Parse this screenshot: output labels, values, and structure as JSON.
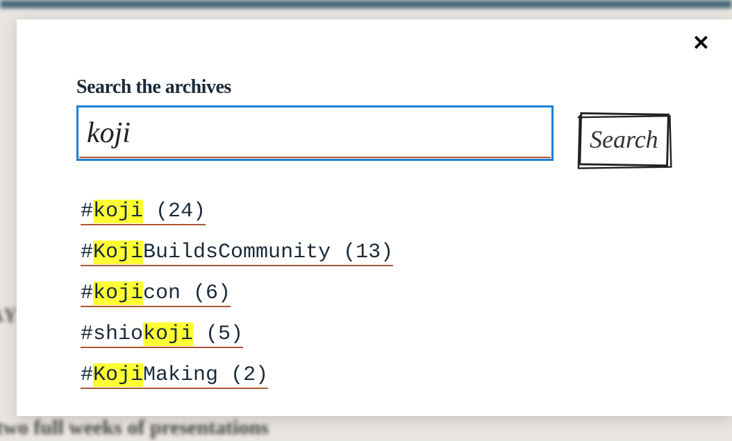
{
  "background": {
    "text1": "AY",
    "text2": "...",
    "text3": "n two full weeks of presentations"
  },
  "modal": {
    "close_label": "✕",
    "search": {
      "label": "Search the archives",
      "input_value": "koji",
      "button_label": "Search"
    },
    "results": [
      {
        "prefix": "#",
        "before": "",
        "match": "koji",
        "after": "",
        "count": "(24)"
      },
      {
        "prefix": "#",
        "before": "",
        "match": "Koji",
        "after": "BuildsCommunity",
        "count": "(13)"
      },
      {
        "prefix": "#",
        "before": "",
        "match": "koji",
        "after": "con",
        "count": "(6)"
      },
      {
        "prefix": "#",
        "before": "shio",
        "match": "koji",
        "after": "",
        "count": "(5)"
      },
      {
        "prefix": "#",
        "before": "",
        "match": "Koji",
        "after": "Making",
        "count": "(2)"
      }
    ]
  }
}
